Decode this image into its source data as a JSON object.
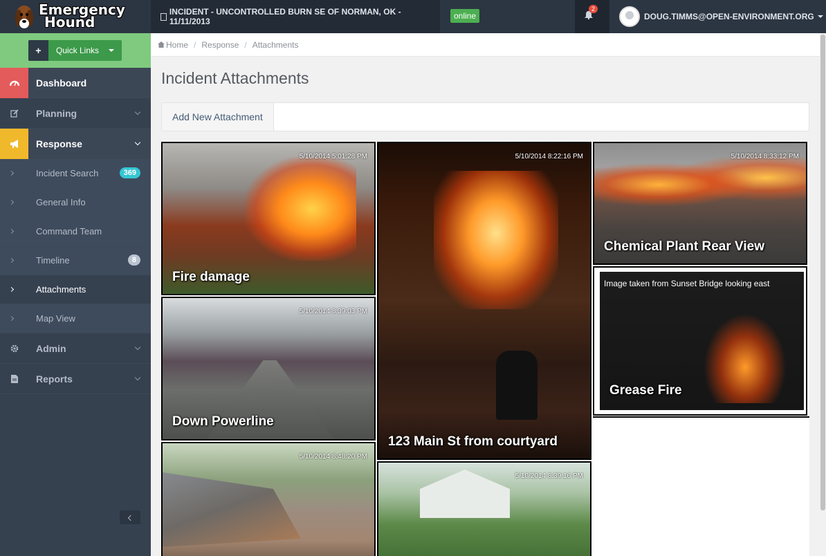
{
  "app": {
    "brand_line1": "Emergency",
    "brand_line2": "Hound",
    "incident": "INCIDENT - UNCONTROLLED BURN SE OF NORMAN, OK - 11/11/2013",
    "status": "online",
    "notifications": "2",
    "user": "DOUG.TIMMS@OPEN-ENVIRONMENT.ORG"
  },
  "sidebar": {
    "quick_links": "Quick Links",
    "items": [
      {
        "label": "Dashboard",
        "icon": "dashboard-icon"
      },
      {
        "label": "Planning",
        "icon": "edit-icon"
      },
      {
        "label": "Response",
        "icon": "megaphone-icon"
      },
      {
        "label": "Admin",
        "icon": "gear-icon"
      },
      {
        "label": "Reports",
        "icon": "document-icon"
      }
    ],
    "sub_items": [
      {
        "label": "Incident Search",
        "badge": "369"
      },
      {
        "label": "General Info"
      },
      {
        "label": "Command Team"
      },
      {
        "label": "Timeline",
        "badge": "8"
      },
      {
        "label": "Attachments"
      },
      {
        "label": "Map View"
      }
    ]
  },
  "breadcrumb": [
    "Home",
    "Response",
    "Attachments"
  ],
  "page": {
    "title": "Incident Attachments",
    "add_button": "Add New Attachment"
  },
  "attachments": [
    {
      "caption": "Fire damage",
      "timestamp": "5/10/2014 5:01:28 PM"
    },
    {
      "caption": "Down Powerline",
      "timestamp": "5/10/2014 8:39:03 PM"
    },
    {
      "caption": "",
      "timestamp": "5/10/2014 8:48:20 PM"
    },
    {
      "caption": "123 Main St from courtyard",
      "timestamp": "5/10/2014 8:22:16 PM"
    },
    {
      "caption": "",
      "timestamp": "5/10/2014 8:39:16 PM"
    },
    {
      "caption": "Chemical Plant Rear View",
      "timestamp": "5/10/2014 8:33:12 PM"
    },
    {
      "caption": "Grease Fire",
      "description": "Image taken from Sunset Bridge looking east"
    }
  ],
  "colors": {
    "header": "#2c3542",
    "sidebar": "#364150",
    "quick_links_bg": "#7fca7f",
    "dashboard_accent": "#e35b5a",
    "response_accent": "#f0b92b",
    "online": "#4caf50",
    "badge_teal": "#36c6d3"
  }
}
